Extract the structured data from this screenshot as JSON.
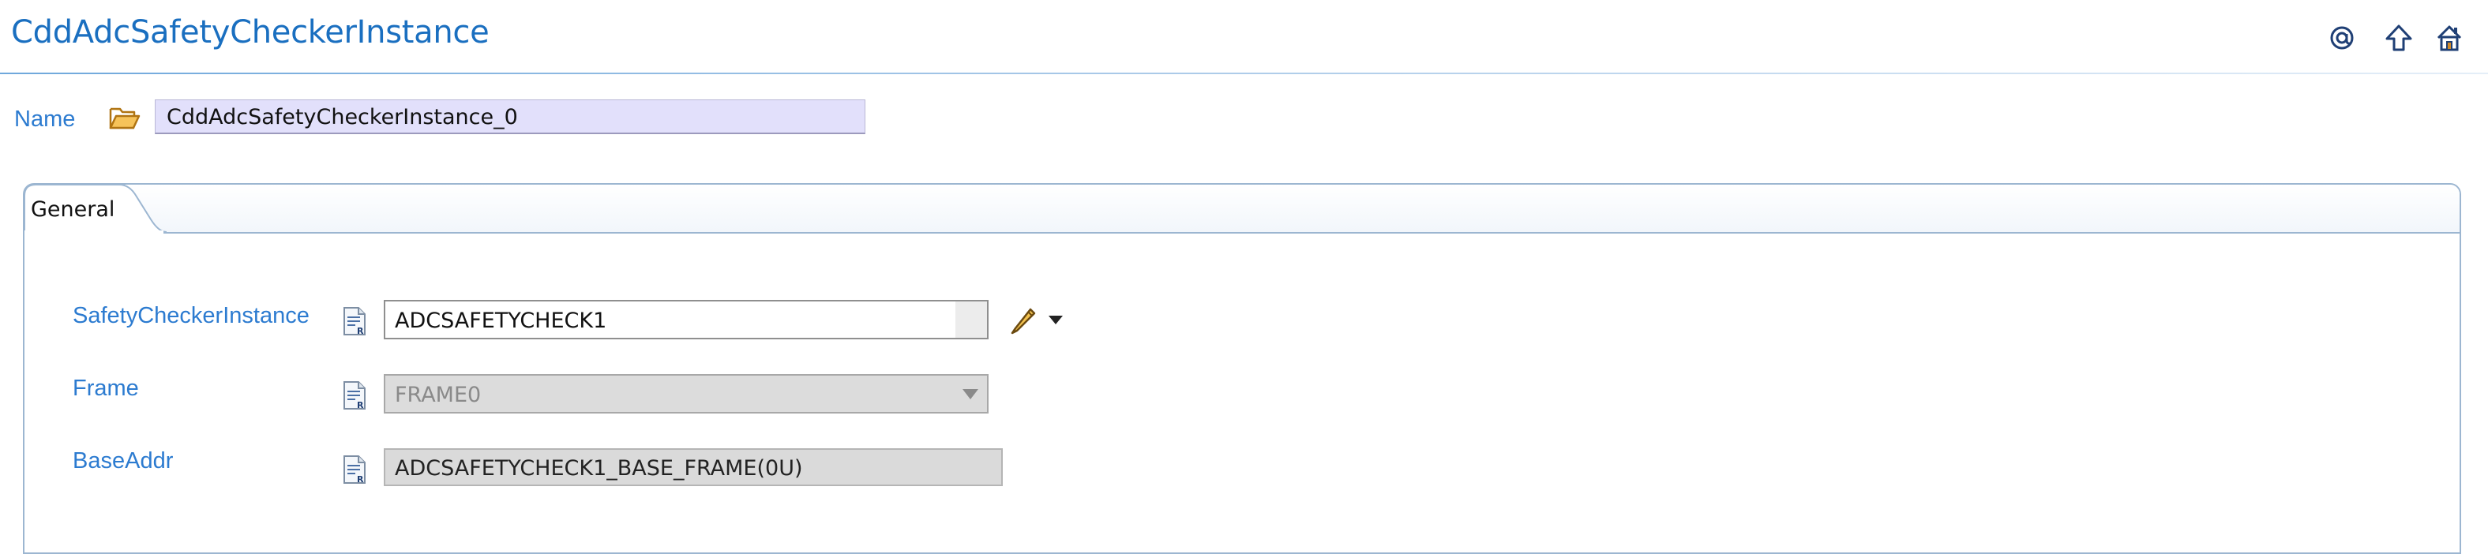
{
  "header": {
    "title": "CddAdcSafetyCheckerInstance",
    "icons": [
      "at-icon",
      "up-arrow-icon",
      "home-icon"
    ]
  },
  "name_row": {
    "label": "Name",
    "value": "CddAdcSafetyCheckerInstance_0"
  },
  "tabs": [
    {
      "label": "General",
      "active": true
    }
  ],
  "fields": {
    "safety_checker_instance": {
      "label": "SafetyCheckerInstance",
      "value": "ADCSAFETYCHECK1"
    },
    "frame": {
      "label": "Frame",
      "value": "FRAME0"
    },
    "base_addr": {
      "label": "BaseAddr",
      "value": "ADCSAFETYCHECK1_BASE_FRAME(0U)"
    }
  },
  "colors": {
    "title": "#1a6fc0",
    "label": "#2c7bd0",
    "name_field_bg": "#e2e0fb",
    "panel_border": "#9cb6d1",
    "disabled_bg": "#dcdcdc"
  }
}
